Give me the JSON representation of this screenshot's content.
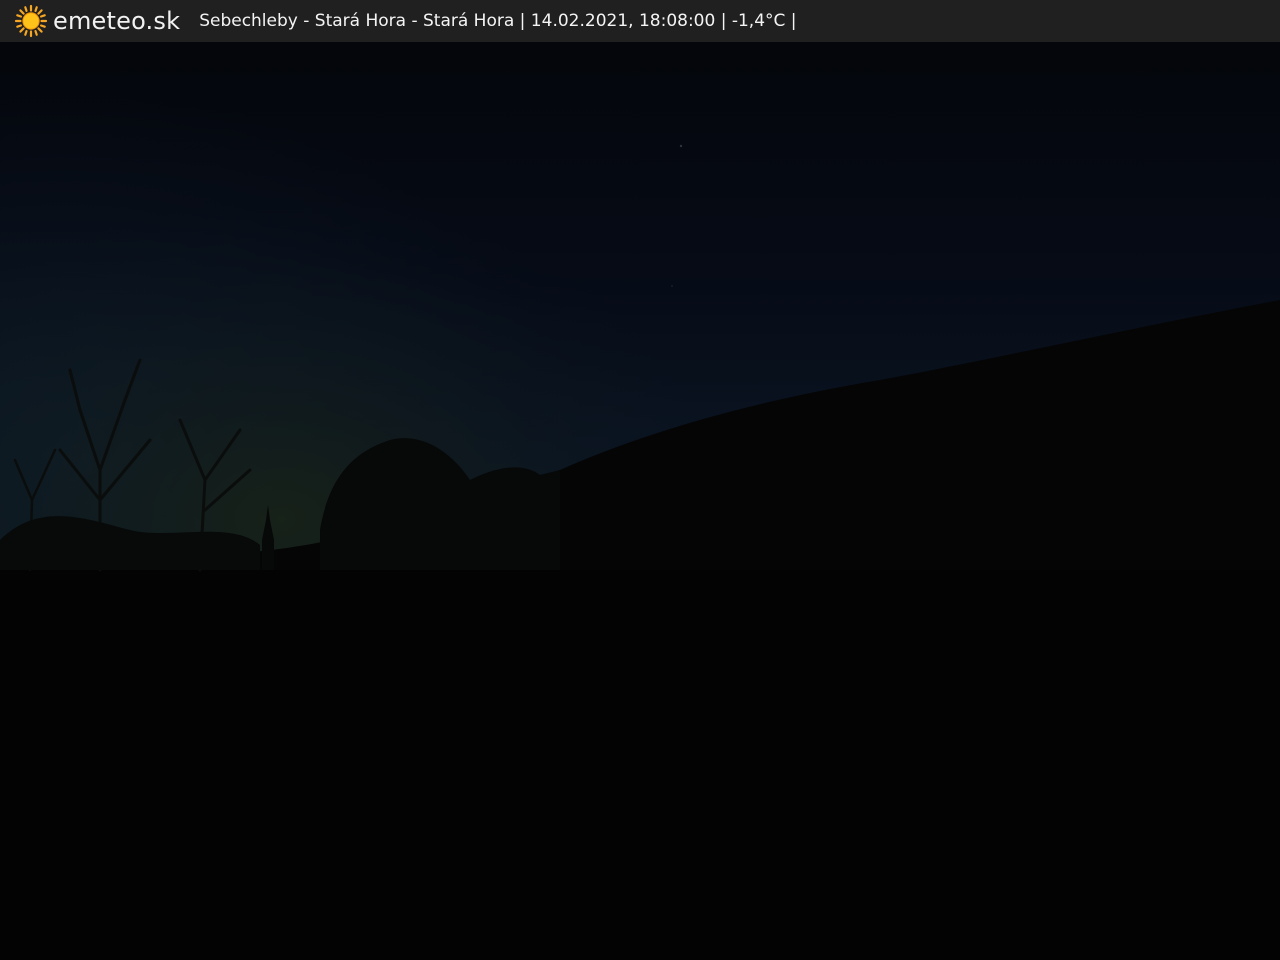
{
  "header": {
    "brand": "emeteo.sk",
    "caption": "Sebechleby - Stará Hora - Stará Hora | 14.02.2021, 18:08:00 | -1,4°C |",
    "logo_icon": "sun-icon",
    "accent_color": "#f5a623",
    "bar_color": "#202020"
  }
}
